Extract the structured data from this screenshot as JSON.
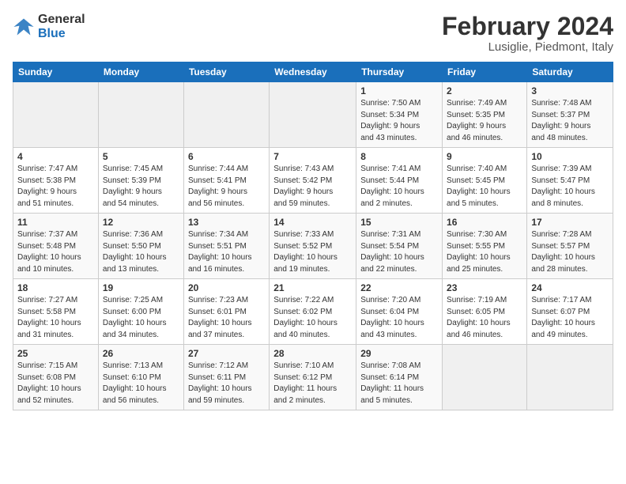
{
  "header": {
    "logo_line1": "General",
    "logo_line2": "Blue",
    "title": "February 2024",
    "subtitle": "Lusiglie, Piedmont, Italy"
  },
  "days_of_week": [
    "Sunday",
    "Monday",
    "Tuesday",
    "Wednesday",
    "Thursday",
    "Friday",
    "Saturday"
  ],
  "weeks": [
    [
      {
        "day": "",
        "info": ""
      },
      {
        "day": "",
        "info": ""
      },
      {
        "day": "",
        "info": ""
      },
      {
        "day": "",
        "info": ""
      },
      {
        "day": "1",
        "info": "Sunrise: 7:50 AM\nSunset: 5:34 PM\nDaylight: 9 hours\nand 43 minutes."
      },
      {
        "day": "2",
        "info": "Sunrise: 7:49 AM\nSunset: 5:35 PM\nDaylight: 9 hours\nand 46 minutes."
      },
      {
        "day": "3",
        "info": "Sunrise: 7:48 AM\nSunset: 5:37 PM\nDaylight: 9 hours\nand 48 minutes."
      }
    ],
    [
      {
        "day": "4",
        "info": "Sunrise: 7:47 AM\nSunset: 5:38 PM\nDaylight: 9 hours\nand 51 minutes."
      },
      {
        "day": "5",
        "info": "Sunrise: 7:45 AM\nSunset: 5:39 PM\nDaylight: 9 hours\nand 54 minutes."
      },
      {
        "day": "6",
        "info": "Sunrise: 7:44 AM\nSunset: 5:41 PM\nDaylight: 9 hours\nand 56 minutes."
      },
      {
        "day": "7",
        "info": "Sunrise: 7:43 AM\nSunset: 5:42 PM\nDaylight: 9 hours\nand 59 minutes."
      },
      {
        "day": "8",
        "info": "Sunrise: 7:41 AM\nSunset: 5:44 PM\nDaylight: 10 hours\nand 2 minutes."
      },
      {
        "day": "9",
        "info": "Sunrise: 7:40 AM\nSunset: 5:45 PM\nDaylight: 10 hours\nand 5 minutes."
      },
      {
        "day": "10",
        "info": "Sunrise: 7:39 AM\nSunset: 5:47 PM\nDaylight: 10 hours\nand 8 minutes."
      }
    ],
    [
      {
        "day": "11",
        "info": "Sunrise: 7:37 AM\nSunset: 5:48 PM\nDaylight: 10 hours\nand 10 minutes."
      },
      {
        "day": "12",
        "info": "Sunrise: 7:36 AM\nSunset: 5:50 PM\nDaylight: 10 hours\nand 13 minutes."
      },
      {
        "day": "13",
        "info": "Sunrise: 7:34 AM\nSunset: 5:51 PM\nDaylight: 10 hours\nand 16 minutes."
      },
      {
        "day": "14",
        "info": "Sunrise: 7:33 AM\nSunset: 5:52 PM\nDaylight: 10 hours\nand 19 minutes."
      },
      {
        "day": "15",
        "info": "Sunrise: 7:31 AM\nSunset: 5:54 PM\nDaylight: 10 hours\nand 22 minutes."
      },
      {
        "day": "16",
        "info": "Sunrise: 7:30 AM\nSunset: 5:55 PM\nDaylight: 10 hours\nand 25 minutes."
      },
      {
        "day": "17",
        "info": "Sunrise: 7:28 AM\nSunset: 5:57 PM\nDaylight: 10 hours\nand 28 minutes."
      }
    ],
    [
      {
        "day": "18",
        "info": "Sunrise: 7:27 AM\nSunset: 5:58 PM\nDaylight: 10 hours\nand 31 minutes."
      },
      {
        "day": "19",
        "info": "Sunrise: 7:25 AM\nSunset: 6:00 PM\nDaylight: 10 hours\nand 34 minutes."
      },
      {
        "day": "20",
        "info": "Sunrise: 7:23 AM\nSunset: 6:01 PM\nDaylight: 10 hours\nand 37 minutes."
      },
      {
        "day": "21",
        "info": "Sunrise: 7:22 AM\nSunset: 6:02 PM\nDaylight: 10 hours\nand 40 minutes."
      },
      {
        "day": "22",
        "info": "Sunrise: 7:20 AM\nSunset: 6:04 PM\nDaylight: 10 hours\nand 43 minutes."
      },
      {
        "day": "23",
        "info": "Sunrise: 7:19 AM\nSunset: 6:05 PM\nDaylight: 10 hours\nand 46 minutes."
      },
      {
        "day": "24",
        "info": "Sunrise: 7:17 AM\nSunset: 6:07 PM\nDaylight: 10 hours\nand 49 minutes."
      }
    ],
    [
      {
        "day": "25",
        "info": "Sunrise: 7:15 AM\nSunset: 6:08 PM\nDaylight: 10 hours\nand 52 minutes."
      },
      {
        "day": "26",
        "info": "Sunrise: 7:13 AM\nSunset: 6:10 PM\nDaylight: 10 hours\nand 56 minutes."
      },
      {
        "day": "27",
        "info": "Sunrise: 7:12 AM\nSunset: 6:11 PM\nDaylight: 10 hours\nand 59 minutes."
      },
      {
        "day": "28",
        "info": "Sunrise: 7:10 AM\nSunset: 6:12 PM\nDaylight: 11 hours\nand 2 minutes."
      },
      {
        "day": "29",
        "info": "Sunrise: 7:08 AM\nSunset: 6:14 PM\nDaylight: 11 hours\nand 5 minutes."
      },
      {
        "day": "",
        "info": ""
      },
      {
        "day": "",
        "info": ""
      }
    ]
  ]
}
